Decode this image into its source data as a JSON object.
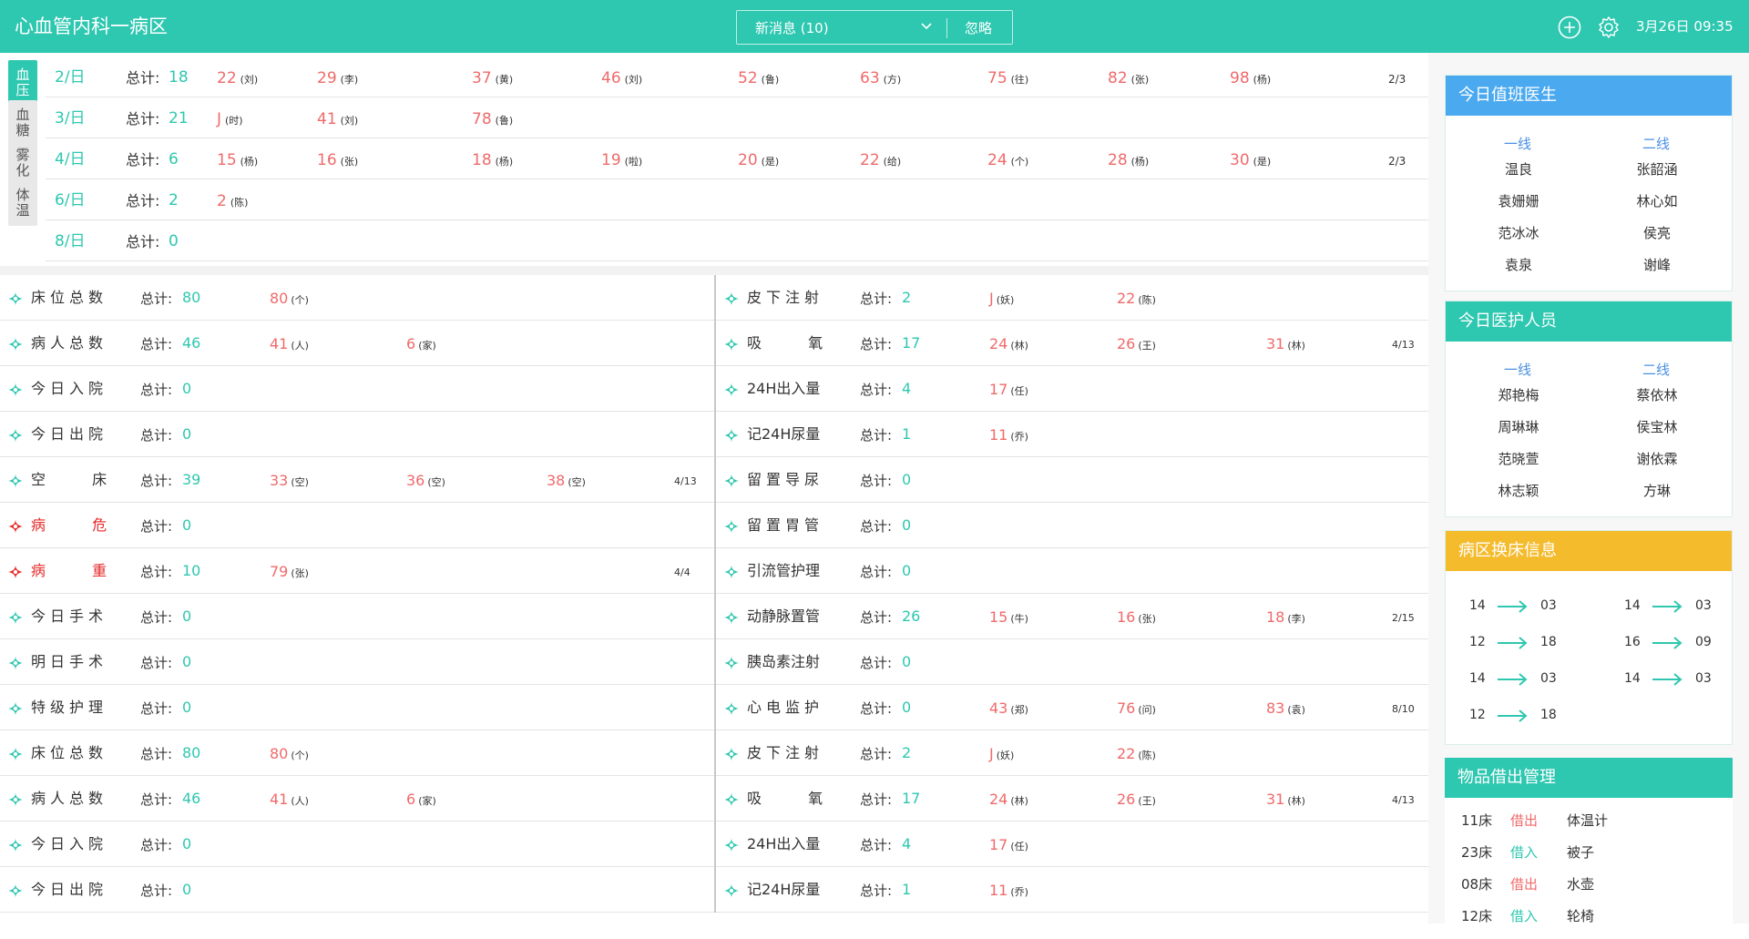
{
  "colors": {
    "accent": "#2ec7b0",
    "danger": "#e62828",
    "number_red": "#f06a6a",
    "blue": "#4a90e2",
    "amber": "#f4bb2d"
  },
  "header": {
    "title": "心血管内科一病区",
    "message_label": "新消息 (10)",
    "ignore_label": "忽略",
    "add_icon": "plus-circle-icon",
    "settings_icon": "gear-icon",
    "datetime": "3月26日 09:35"
  },
  "vitals": {
    "tabs": [
      {
        "label": "血压",
        "active": true
      },
      {
        "label": "血糖",
        "active": false
      },
      {
        "label": "雾化",
        "active": false
      },
      {
        "label": "体温",
        "active": false
      }
    ],
    "rows": [
      {
        "date": "2/日",
        "total_label": "总计:",
        "total": "18",
        "items": [
          {
            "n": "22",
            "w": "(刘)"
          },
          {
            "n": "29",
            "w": "(李)"
          },
          {
            "n": "37",
            "w": "(黄)"
          },
          {
            "n": "46",
            "w": "(刘)"
          },
          {
            "n": "52",
            "w": "(鲁)"
          },
          {
            "n": "63",
            "w": "(方)"
          },
          {
            "n": "75",
            "w": "(往)"
          },
          {
            "n": "82",
            "w": "(张)"
          },
          {
            "n": "98",
            "w": "(杨)"
          }
        ],
        "page": "2/3"
      },
      {
        "date": "3/日",
        "total_label": "总计:",
        "total": "21",
        "items": [
          {
            "n": "J",
            "w": "(时)"
          },
          {
            "n": "41",
            "w": "(刘)"
          },
          {
            "n": "78",
            "w": "(鲁)"
          }
        ],
        "page": ""
      },
      {
        "date": "4/日",
        "total_label": "总计:",
        "total": "6",
        "items": [
          {
            "n": "15",
            "w": "(杨)"
          },
          {
            "n": "16",
            "w": "(张)"
          },
          {
            "n": "18",
            "w": "(杨)"
          },
          {
            "n": "19",
            "w": "(啦)"
          },
          {
            "n": "20",
            "w": "(是)"
          },
          {
            "n": "22",
            "w": "(给)"
          },
          {
            "n": "24",
            "w": "(个)"
          },
          {
            "n": "28",
            "w": "(杨)"
          },
          {
            "n": "30",
            "w": "(是)"
          }
        ],
        "page": "2/3"
      },
      {
        "date": "6/日",
        "total_label": "总计:",
        "total": "2",
        "items": [
          {
            "n": "2",
            "w": "(陈)"
          }
        ],
        "page": ""
      },
      {
        "date": "8/日",
        "total_label": "总计:",
        "total": "0",
        "items": [],
        "page": ""
      }
    ]
  },
  "stats_left": [
    {
      "label": "床位总数",
      "style": "sp",
      "total_label": "总计:",
      "total": "80",
      "items": [
        {
          "n": "80",
          "w": "(个)"
        }
      ],
      "page": ""
    },
    {
      "label": "病人总数",
      "style": "sp",
      "total_label": "总计:",
      "total": "46",
      "items": [
        {
          "n": "41",
          "w": "(人)"
        },
        {
          "n": "6",
          "w": "(家)"
        }
      ],
      "page": ""
    },
    {
      "label": "今日入院",
      "style": "sp",
      "total_label": "总计:",
      "total": "0",
      "items": [],
      "page": ""
    },
    {
      "label": "今日出院",
      "style": "sp",
      "total_label": "总计:",
      "total": "0",
      "items": [],
      "page": ""
    },
    {
      "label": "空 床",
      "style": "wide",
      "total_label": "总计:",
      "total": "39",
      "items": [
        {
          "n": "33",
          "w": "(空)"
        },
        {
          "n": "36",
          "w": "(空)"
        },
        {
          "n": "38",
          "w": "(空)"
        }
      ],
      "page": "4/13"
    },
    {
      "label": "病 危",
      "style": "wide red",
      "icon": "red",
      "total_label": "总计:",
      "total": "0",
      "items": [],
      "page": ""
    },
    {
      "label": "病 重",
      "style": "wide red",
      "icon": "red",
      "total_label": "总计:",
      "total": "10",
      "items": [
        {
          "n": "79",
          "w": "(张)"
        }
      ],
      "page": "4/4"
    },
    {
      "label": "今日手术",
      "style": "sp",
      "total_label": "总计:",
      "total": "0",
      "items": [],
      "page": ""
    },
    {
      "label": "明日手术",
      "style": "sp",
      "total_label": "总计:",
      "total": "0",
      "items": [],
      "page": ""
    },
    {
      "label": "特级护理",
      "style": "sp",
      "total_label": "总计:",
      "total": "0",
      "items": [],
      "page": ""
    },
    {
      "label": "床位总数",
      "style": "sp",
      "total_label": "总计:",
      "total": "80",
      "items": [
        {
          "n": "80",
          "w": "(个)"
        }
      ],
      "page": ""
    },
    {
      "label": "病人总数",
      "style": "sp",
      "total_label": "总计:",
      "total": "46",
      "items": [
        {
          "n": "41",
          "w": "(人)"
        },
        {
          "n": "6",
          "w": "(家)"
        }
      ],
      "page": ""
    },
    {
      "label": "今日入院",
      "style": "sp",
      "total_label": "总计:",
      "total": "0",
      "items": [],
      "page": ""
    },
    {
      "label": "今日出院",
      "style": "sp",
      "total_label": "总计:",
      "total": "0",
      "items": [],
      "page": ""
    }
  ],
  "stats_right": [
    {
      "label": "皮下注射",
      "style": "sp",
      "total_label": "总计:",
      "total": "2",
      "items": [
        {
          "n": "J",
          "w": "(妖)"
        },
        {
          "n": "22",
          "w": "(陈)"
        }
      ],
      "page": ""
    },
    {
      "label": "吸 氧",
      "style": "wide",
      "total_label": "总计:",
      "total": "17",
      "items": [
        {
          "n": "24",
          "w": "(林)"
        },
        {
          "n": "26",
          "w": "(王)"
        },
        {
          "n": "31",
          "w": "(林)"
        }
      ],
      "page": "4/13"
    },
    {
      "label": "24H出入量",
      "style": "",
      "total_label": "总计:",
      "total": "4",
      "items": [
        {
          "n": "17",
          "w": "(任)"
        }
      ],
      "page": ""
    },
    {
      "label": "记24H尿量",
      "style": "",
      "total_label": "总计:",
      "total": "1",
      "items": [
        {
          "n": "11",
          "w": "(乔)"
        }
      ],
      "page": ""
    },
    {
      "label": "留置导尿",
      "style": "sp",
      "total_label": "总计:",
      "total": "0",
      "items": [],
      "page": ""
    },
    {
      "label": "留置胃管",
      "style": "sp",
      "total_label": "总计:",
      "total": "0",
      "items": [],
      "page": ""
    },
    {
      "label": "引流管护理",
      "style": "",
      "total_label": "总计:",
      "total": "0",
      "items": [],
      "page": ""
    },
    {
      "label": "动静脉置管",
      "style": "",
      "total_label": "总计:",
      "total": "26",
      "items": [
        {
          "n": "15",
          "w": "(牛)"
        },
        {
          "n": "16",
          "w": "(张)"
        },
        {
          "n": "18",
          "w": "(李)"
        }
      ],
      "page": "2/15"
    },
    {
      "label": "胰岛素注射",
      "style": "",
      "total_label": "总计:",
      "total": "0",
      "items": [],
      "page": ""
    },
    {
      "label": "心电监护",
      "style": "sp",
      "total_label": "总计:",
      "total": "0",
      "items": [
        {
          "n": "43",
          "w": "(郑)"
        },
        {
          "n": "76",
          "w": "(问)"
        },
        {
          "n": "83",
          "w": "(袁)"
        }
      ],
      "page": "8/10"
    },
    {
      "label": "皮下注射",
      "style": "sp",
      "total_label": "总计:",
      "total": "2",
      "items": [
        {
          "n": "J",
          "w": "(妖)"
        },
        {
          "n": "22",
          "w": "(陈)"
        }
      ],
      "page": ""
    },
    {
      "label": "吸 氧",
      "style": "wide",
      "total_label": "总计:",
      "total": "17",
      "items": [
        {
          "n": "24",
          "w": "(林)"
        },
        {
          "n": "26",
          "w": "(王)"
        },
        {
          "n": "31",
          "w": "(林)"
        }
      ],
      "page": "4/13"
    },
    {
      "label": "24H出入量",
      "style": "",
      "total_label": "总计:",
      "total": "4",
      "items": [
        {
          "n": "17",
          "w": "(任)"
        }
      ],
      "page": ""
    },
    {
      "label": "记24H尿量",
      "style": "",
      "total_label": "总计:",
      "total": "1",
      "items": [
        {
          "n": "11",
          "w": "(乔)"
        }
      ],
      "page": ""
    }
  ],
  "sidebar": {
    "doctors": {
      "title": "今日值班医生",
      "col1_label": "一线",
      "col2_label": "二线",
      "col1": [
        "温良",
        "袁姗姗",
        "范冰冰",
        "袁泉"
      ],
      "col2": [
        "张韶涵",
        "林心如",
        "侯亮",
        "谢峰"
      ]
    },
    "nurses": {
      "title": "今日医护人员",
      "col1_label": "一线",
      "col2_label": "二线",
      "col1": [
        "郑艳梅",
        "周琳琳",
        "范晓萱",
        "林志颖"
      ],
      "col2": [
        "蔡依林",
        "侯宝林",
        "谢依霖",
        "方琳"
      ]
    },
    "bedchange": {
      "title": "病区换床信息",
      "items": [
        {
          "from": "14",
          "to": "03"
        },
        {
          "from": "14",
          "to": "03"
        },
        {
          "from": "12",
          "to": "18"
        },
        {
          "from": "16",
          "to": "09"
        },
        {
          "from": "14",
          "to": "03"
        },
        {
          "from": "14",
          "to": "03"
        },
        {
          "from": "12",
          "to": "18"
        }
      ]
    },
    "loans": {
      "title": "物品借出管理",
      "items": [
        {
          "bed": "11床",
          "action": "借出",
          "type": "out",
          "item": "体温计"
        },
        {
          "bed": "23床",
          "action": "借入",
          "type": "in",
          "item": "被子"
        },
        {
          "bed": "08床",
          "action": "借出",
          "type": "out",
          "item": "水壶"
        },
        {
          "bed": "12床",
          "action": "借入",
          "type": "in",
          "item": "轮椅"
        }
      ]
    }
  }
}
